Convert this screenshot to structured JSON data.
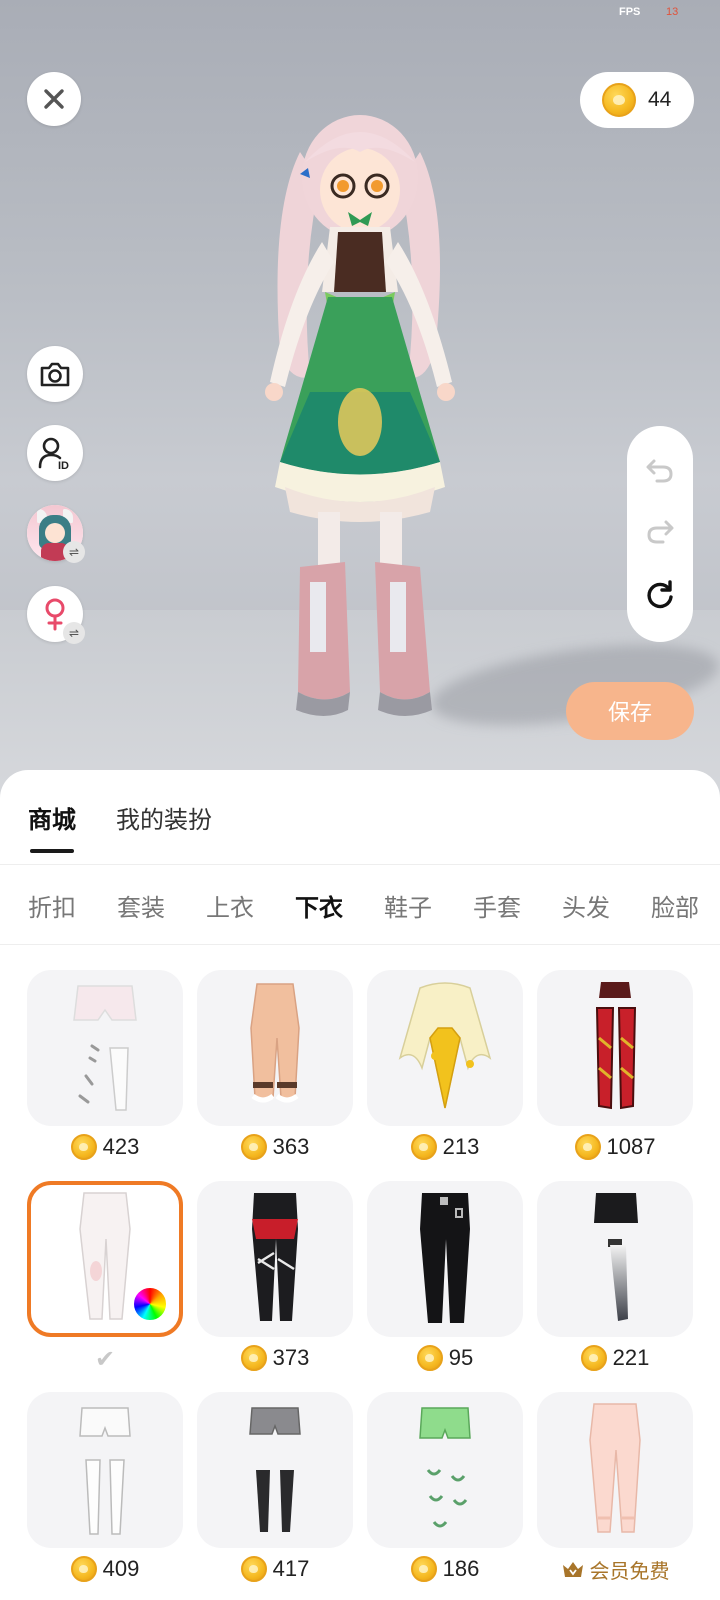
{
  "status": {
    "fps_label": "FPS",
    "fps_value": "13"
  },
  "wallet": {
    "coins": "44"
  },
  "actions": {
    "save_label": "保存"
  },
  "main_tabs": [
    {
      "label": "商城",
      "active": true
    },
    {
      "label": "我的装扮",
      "active": false
    }
  ],
  "categories": [
    {
      "label": "折扣",
      "active": false
    },
    {
      "label": "套装",
      "active": false
    },
    {
      "label": "上衣",
      "active": false
    },
    {
      "label": "下衣",
      "active": true
    },
    {
      "label": "鞋子",
      "active": false
    },
    {
      "label": "手套",
      "active": false
    },
    {
      "label": "头发",
      "active": false
    },
    {
      "label": "脸部",
      "active": false
    }
  ],
  "items": [
    {
      "price": "423"
    },
    {
      "price": "363"
    },
    {
      "price": "213"
    },
    {
      "price": "1087"
    },
    {
      "price": "",
      "selected": true
    },
    {
      "price": "373"
    },
    {
      "price": "95"
    },
    {
      "price": "221"
    },
    {
      "price": "409"
    },
    {
      "price": "417"
    },
    {
      "price": "186"
    },
    {
      "vip_label": "会员免费"
    }
  ],
  "colors": {
    "accent_orange": "#ef7a25",
    "save_button": "#f7b58c",
    "coin": "#f5b820",
    "vip": "#a8752a"
  },
  "icons": [
    "close-icon",
    "coin-icon",
    "camera-icon",
    "id-icon",
    "avatar-switch-icon",
    "gender-female-icon",
    "undo-icon",
    "redo-icon",
    "reset-icon",
    "color-wheel-icon",
    "check-icon",
    "vip-crown-icon"
  ]
}
